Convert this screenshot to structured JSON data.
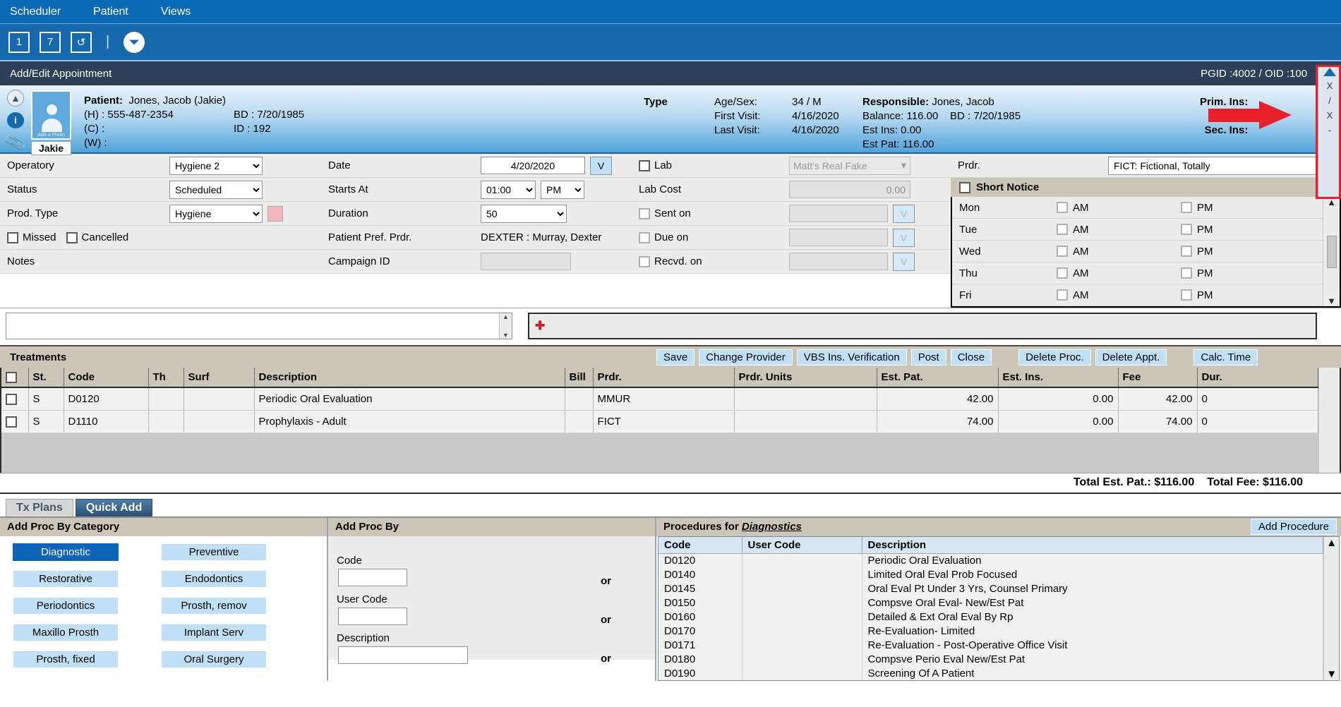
{
  "menu": {
    "items": [
      "Scheduler",
      "Patient",
      "Views"
    ]
  },
  "toolbar": {
    "buttons": [
      "1",
      "7",
      "↺"
    ],
    "separator": "|",
    "expand_icon": "chevron-double-down"
  },
  "window": {
    "title": "Add/Edit Appointment",
    "pgid_oid": "PGID :4002  /  OID :100",
    "printer_icon": "printer"
  },
  "patient": {
    "label": "Patient:",
    "name": "Jones, Jacob (Jakie)",
    "home_label": "(H) :",
    "home_phone": "555-487-2354",
    "cell_label": "(C) :",
    "cell_phone": "",
    "work_label": "(W) :",
    "work_phone": "",
    "bd_label": "BD : 7/20/1985",
    "id_label": "ID : 192",
    "nickname": "Jakie",
    "add_photo": "Add a Photo",
    "type_label": "Type",
    "visit": {
      "age_sex_label": "Age/Sex:",
      "age_sex": "34 / M",
      "first_label": "First Visit:",
      "first": "4/16/2020",
      "last_label": "Last Visit:",
      "last": "4/16/2020"
    },
    "responsible": {
      "label": "Responsible:",
      "name": "Jones, Jacob",
      "balance": "Balance: 116.00",
      "bd": "BD : 7/20/1985",
      "est_ins": "Est Ins:  0.00",
      "est_pat": "Est Pat: 116.00"
    },
    "insurance": {
      "primary": "Prim. Ins:",
      "secondary": "Sec. Ins:"
    }
  },
  "form": {
    "operatory_label": "Operatory",
    "operatory_value": "Hygiene 2",
    "status_label": "Status",
    "status_value": "Scheduled",
    "prod_type_label": "Prod. Type",
    "prod_type_value": "Hygiene",
    "prod_color": "#f3b7be",
    "missed_label": "Missed",
    "cancelled_label": "Cancelled",
    "notes_label": "Notes",
    "notes_value": "",
    "date_label": "Date",
    "date_value": "4/20/2020",
    "date_btn": "V",
    "starts_label": "Starts At",
    "starts_value": "01:00",
    "meridiem_value": "PM",
    "duration_label": "Duration",
    "duration_value": "50",
    "pref_prdr_label": "Patient Pref. Prdr.",
    "pref_prdr_value": "DEXTER : Murray, Dexter",
    "campaign_label": "Campaign ID",
    "campaign_value": "",
    "lab_label": "Lab",
    "lab_vendor": "Matt's Real Fake",
    "lab_cost_label": "Lab Cost",
    "lab_cost_value": "0.00",
    "sent_on_label": "Sent on",
    "sent_on_value": "",
    "due_on_label": "Due on",
    "due_on_value": "",
    "recvd_on_label": "Recvd. on",
    "recvd_on_value": "",
    "prdr_label": "Prdr.",
    "prdr_value": "FICT: Fictional, Totally",
    "short_notice_label": "Short Notice",
    "short_notice_days": [
      "Mon",
      "Tue",
      "Wed",
      "Thu",
      "Fri"
    ],
    "am_label": "AM",
    "pm_label": "PM"
  },
  "treatments": {
    "title": "Treatments",
    "buttons": [
      "Save",
      "Change Provider",
      "VBS Ins. Verification",
      "Post",
      "Close"
    ],
    "buttons_right": [
      "Delete Proc.",
      "Delete Appt.",
      "Calc. Time"
    ],
    "columns": [
      "",
      "St.",
      "Code",
      "Th",
      "Surf",
      "Description",
      "Bill",
      "Prdr.",
      "Prdr. Units",
      "Est. Pat.",
      "Est. Ins.",
      "Fee",
      "Dur."
    ],
    "rows": [
      {
        "st": "S",
        "code": "D0120",
        "th": "",
        "surf": "",
        "description": "Periodic Oral Evaluation",
        "bill": "",
        "prdr": "MMUR",
        "prdr_units": "",
        "est_pat": "42.00",
        "est_ins": "0.00",
        "fee": "42.00",
        "dur": "0"
      },
      {
        "st": "S",
        "code": "D1110",
        "th": "",
        "surf": "",
        "description": "Prophylaxis - Adult",
        "bill": "",
        "prdr": "FICT",
        "prdr_units": "",
        "est_pat": "74.00",
        "est_ins": "0.00",
        "fee": "74.00",
        "dur": "0"
      }
    ],
    "total_est_pat": "Total Est. Pat.: $116.00",
    "total_fee": "Total Fee: $116.00"
  },
  "tabs": {
    "items": [
      "Tx Plans",
      "Quick Add"
    ],
    "active": "Quick Add"
  },
  "quick_add": {
    "category_panel_title": "Add Proc By Category",
    "categories_left": [
      "Diagnostic",
      "Restorative",
      "Periodontics",
      "Maxillo Prosth",
      "Prosth, fixed"
    ],
    "categories_right": [
      "Preventive",
      "Endodontics",
      "Prosth, remov",
      "Implant Serv",
      "Oral Surgery"
    ],
    "selected_category": "Diagnostic",
    "proc_by_title": "Add Proc By",
    "code_label": "Code",
    "code_value": "",
    "user_code_label": "User Code",
    "user_code_value": "",
    "description_label": "Description",
    "description_value": "",
    "or_label": "or",
    "procedures_title_prefix": "Procedures for ",
    "procedures_title_category": "Diagnostics",
    "add_procedure_label": "Add Procedure",
    "proc_columns": [
      "Code",
      "User Code",
      "Description"
    ],
    "procedures": [
      {
        "code": "D0120",
        "user_code": "",
        "description": "Periodic Oral Evaluation"
      },
      {
        "code": "D0140",
        "user_code": "",
        "description": "Limited Oral Eval Prob Focused"
      },
      {
        "code": "D0145",
        "user_code": "",
        "description": "Oral Eval Pt Under 3 Yrs, Counsel Primary"
      },
      {
        "code": "D0150",
        "user_code": "",
        "description": "Compsve Oral Eval- New/Est Pat"
      },
      {
        "code": "D0160",
        "user_code": "",
        "description": "Detailed & Ext Oral Eval By Rp"
      },
      {
        "code": "D0170",
        "user_code": "",
        "description": "Re-Evaluation- Limited"
      },
      {
        "code": "D0171",
        "user_code": "",
        "description": "Re-Evaluation - Post-Operative Office Visit"
      },
      {
        "code": "D0180",
        "user_code": "",
        "description": "Compsve Perio Eval New/Est Pat"
      },
      {
        "code": "D0190",
        "user_code": "",
        "description": "Screening Of A Patient"
      }
    ]
  },
  "annotation": {
    "arrow_color": "#e8202a",
    "box_color": "#e8202a"
  },
  "right_strip": {
    "glyphs": [
      "X",
      "/",
      "X",
      "-"
    ]
  }
}
